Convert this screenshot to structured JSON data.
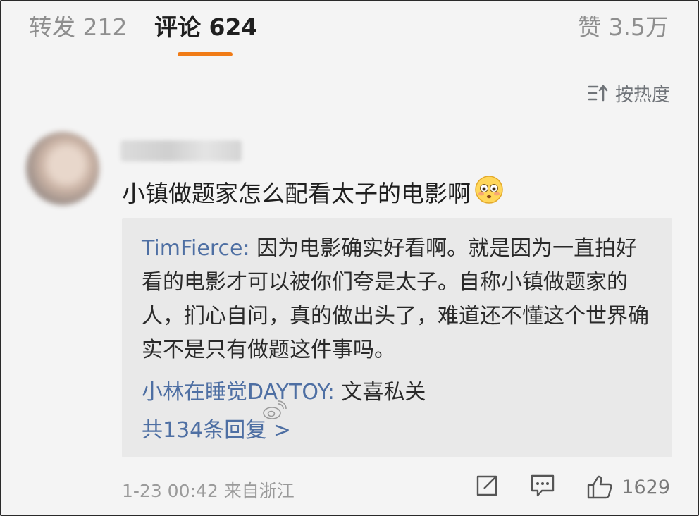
{
  "tabs": {
    "repost": "转发 212",
    "comment": "评论 624",
    "like": "赞 3.5万"
  },
  "sort": {
    "label": "按热度",
    "icon": "sort-icon"
  },
  "comment": {
    "text": "小镇做题家怎么配看太子的电影啊",
    "emoji": "flushed-face-emoji",
    "replies": {
      "main_author": "TimFierce:",
      "main_text": " 因为电影确实好看啊。就是因为一直拍好看的电影才可以被你们夸是太子。自称小镇做题家的人，扪心自问，真的做出头了，难道还不懂这个世界确实不是只有做题这件事吗。",
      "second_author": "小林在睡觉DAYTOY:",
      "second_text": " 文喜私关",
      "more": "共134条回复 >"
    },
    "time": "1-23 00:42",
    "location": "来自浙江",
    "like_count": "1629"
  },
  "colors": {
    "accent": "#f07b16",
    "link": "#4e6fa3"
  }
}
